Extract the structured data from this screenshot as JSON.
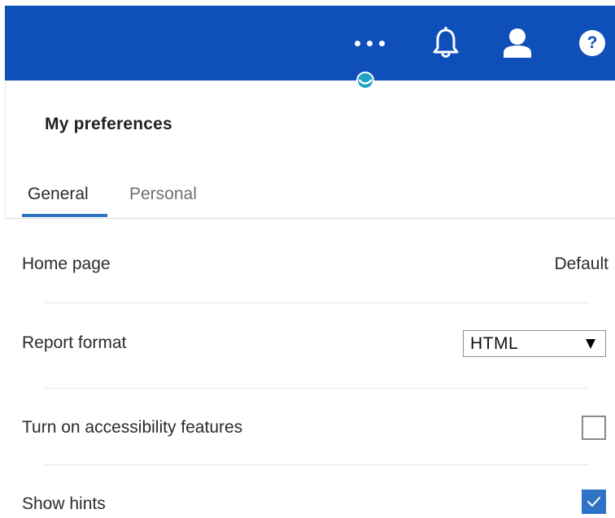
{
  "header": {
    "icons": {
      "more": "more-horizontal-icon",
      "notifications": "bell-icon",
      "user": "user-icon",
      "help_symbol": "?"
    },
    "bg_color": "#0f4fba"
  },
  "panel": {
    "title": "My preferences",
    "tabs": [
      {
        "label": "General",
        "selected": true
      },
      {
        "label": "Personal",
        "selected": false
      }
    ],
    "settings": [
      {
        "label": "Home page",
        "value": "Default"
      },
      {
        "label": "Report format",
        "value": "HTML"
      },
      {
        "label": "Turn on accessibility features",
        "checked": false
      },
      {
        "label": "Show hints",
        "checked": true
      }
    ]
  },
  "colors": {
    "accent": "#2f73c6",
    "text": "#2b2b2b",
    "muted_text": "#6f6f6f"
  }
}
